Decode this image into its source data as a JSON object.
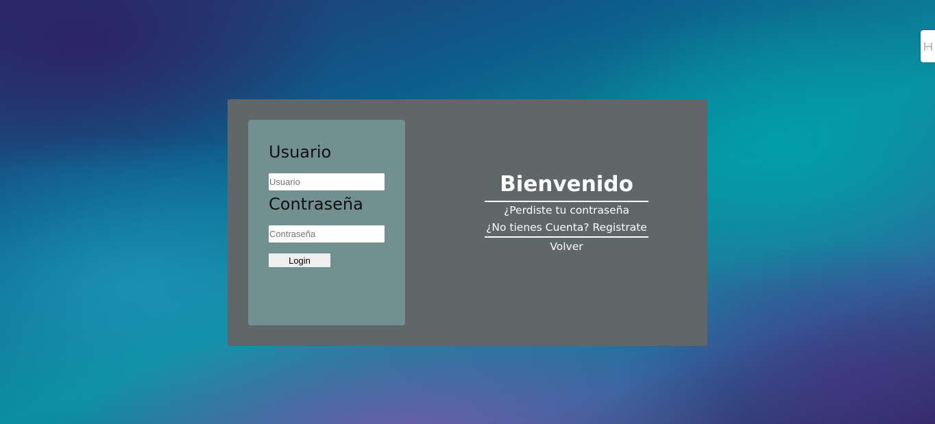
{
  "login": {
    "user_label": "Usuario",
    "user_placeholder": "Usuario",
    "password_label": "Contraseña",
    "password_placeholder": "Contraseña",
    "login_button": "Login"
  },
  "welcome": {
    "title": "Bienvenido",
    "forgot_password_link": "¿Perdiste tu contraseña",
    "register_link": "¿No tienes Cuenta? Registrate",
    "back_link": "Volver"
  },
  "edge_tab": {
    "icon": "extension-tab-icon"
  }
}
